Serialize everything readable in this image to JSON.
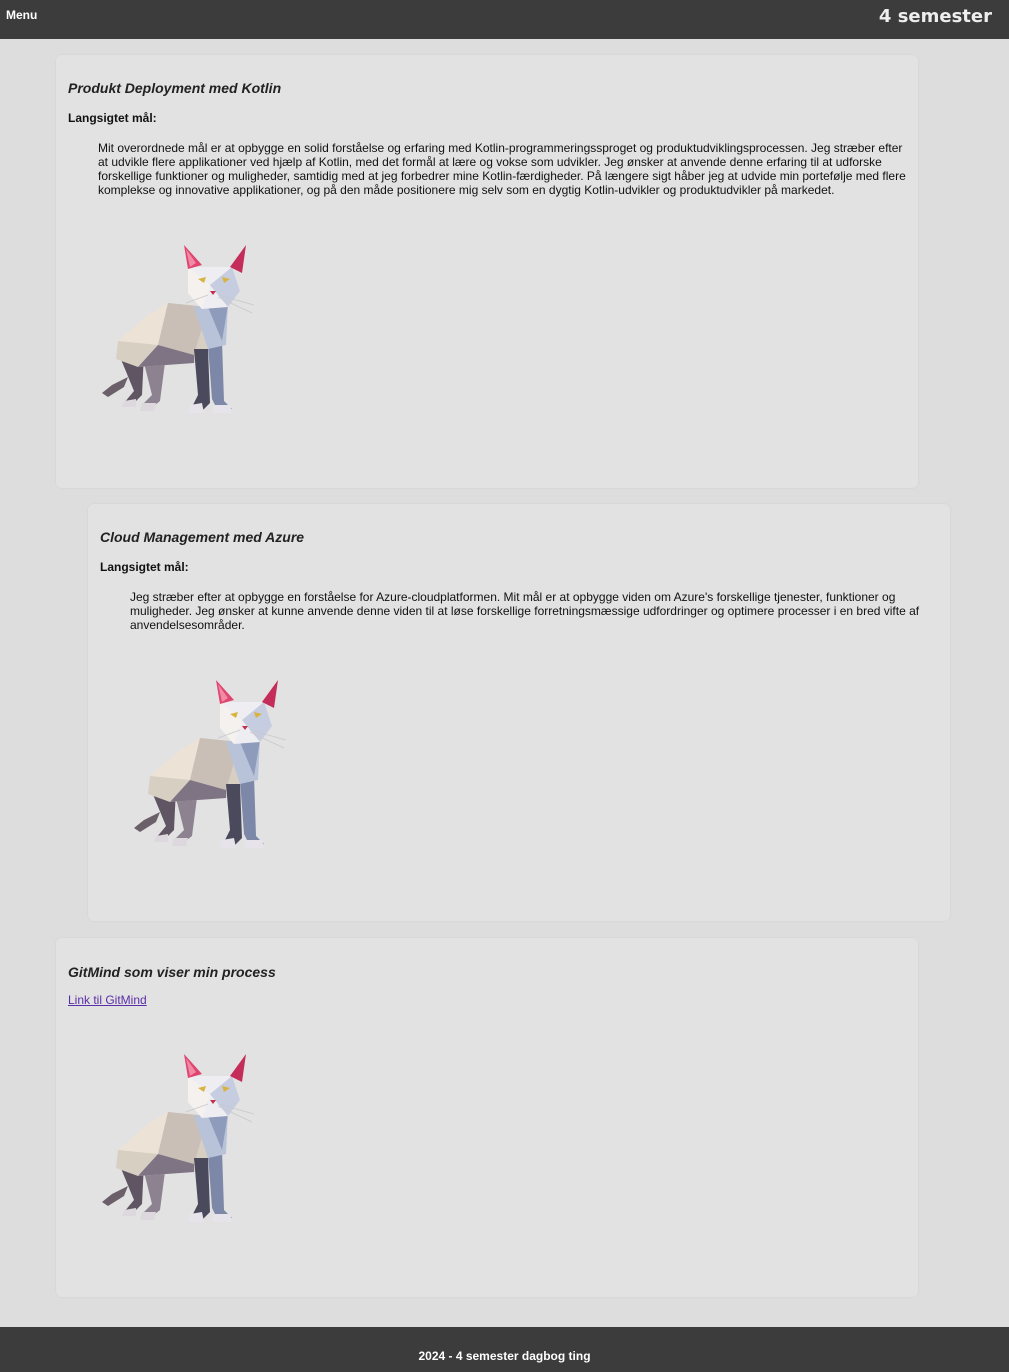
{
  "header": {
    "menu_label": "Menu",
    "title": "4 semester"
  },
  "sections": [
    {
      "title": "Produkt Deployment med Kotlin",
      "subtitle": "Langsigtet mål:",
      "text": "Mit overordnede mål er at opbygge en solid forståelse og erfaring med Kotlin-programmeringssproget og produktudviklingsprocessen. Jeg stræber efter at udvikle flere applikationer ved hjælp af Kotlin, med det formål at lære og vokse som udvikler. Jeg ønsker at anvende denne erfaring til at udforske forskellige funktioner og muligheder, samtidig med at jeg forbedrer mine Kotlin-færdigheder. På længere sigt håber jeg at udvide min portefølje med flere komplekse og innovative applikationer, og på den måde positionere mig selv som en dygtig Kotlin-udvikler og produktudvikler på markedet.",
      "image": "low-poly-cat-image"
    },
    {
      "title": "Cloud Management med Azure",
      "subtitle": "Langsigtet mål:",
      "text": "Jeg stræber efter at opbygge en forståelse for Azure-cloudplatformen. Mit mål er at opbygge viden om Azure's forskellige tjenester, funktioner og muligheder. Jeg ønsker at kunne anvende denne viden til at løse forskellige forretningsmæssige udfordringer og optimere processer i en bred vifte af anvendelsesområder.",
      "image": "low-poly-cat-image"
    },
    {
      "title": "GitMind som viser min process",
      "link_label": "Link til GitMind",
      "image": "low-poly-cat-image"
    }
  ],
  "footer": {
    "text": "2024 - 4 semester dagbog ting"
  },
  "colors": {
    "topbar": "#3c3c3c",
    "background": "#dddddd",
    "card": "#e2e2e2",
    "link": "#5a2ea6",
    "cat_ear": "#e0456f"
  }
}
